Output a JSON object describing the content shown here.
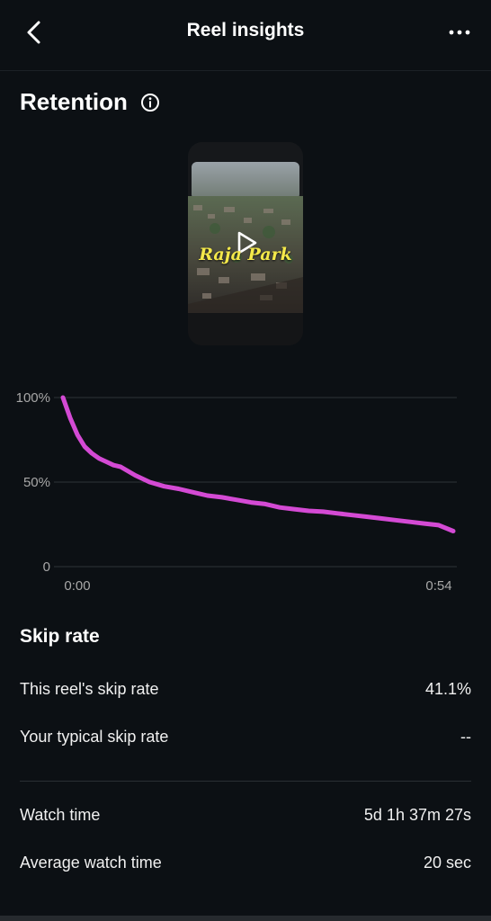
{
  "header": {
    "title": "Reel insights",
    "back_icon": "chevron-left-icon",
    "more_icon": "more-horizontal-icon"
  },
  "retention": {
    "title": "Retention",
    "info_icon": "info-icon",
    "thumbnail": {
      "caption": "Raja Park",
      "play_icon": "play-icon"
    }
  },
  "chart_data": {
    "type": "line",
    "title": "",
    "xlabel": "",
    "ylabel": "",
    "x_ticks": [
      "0:00",
      "0:54"
    ],
    "y_ticks": [
      "100%",
      "50%",
      "0"
    ],
    "xlim": [
      0,
      54
    ],
    "ylim": [
      0,
      100
    ],
    "grid": true,
    "color": "#d44ad4",
    "series": [
      {
        "x": [
          0,
          1,
          2,
          3,
          4,
          5,
          6,
          7,
          8,
          10,
          12,
          14,
          16,
          18,
          20,
          22,
          24,
          26,
          28,
          30,
          32,
          34,
          36,
          38,
          40,
          42,
          44,
          46,
          48,
          50,
          52,
          54
        ],
        "values": [
          100,
          88,
          78,
          71,
          67,
          64,
          62,
          60,
          59,
          54,
          50,
          47.5,
          46,
          44,
          42,
          41,
          39.5,
          38,
          37,
          35,
          34,
          33,
          32.5,
          31.5,
          30.5,
          29.5,
          28.5,
          27.5,
          26.5,
          25.5,
          24.5,
          21
        ]
      }
    ]
  },
  "skip_rate": {
    "title": "Skip rate",
    "rows": [
      {
        "label": "This reel's skip rate",
        "value": "41.1%"
      },
      {
        "label": "Your typical skip rate",
        "value": "--"
      }
    ]
  },
  "watch": {
    "rows": [
      {
        "label": "Watch time",
        "value": "5d 1h 37m 27s"
      },
      {
        "label": "Average watch time",
        "value": "20 sec"
      }
    ]
  }
}
